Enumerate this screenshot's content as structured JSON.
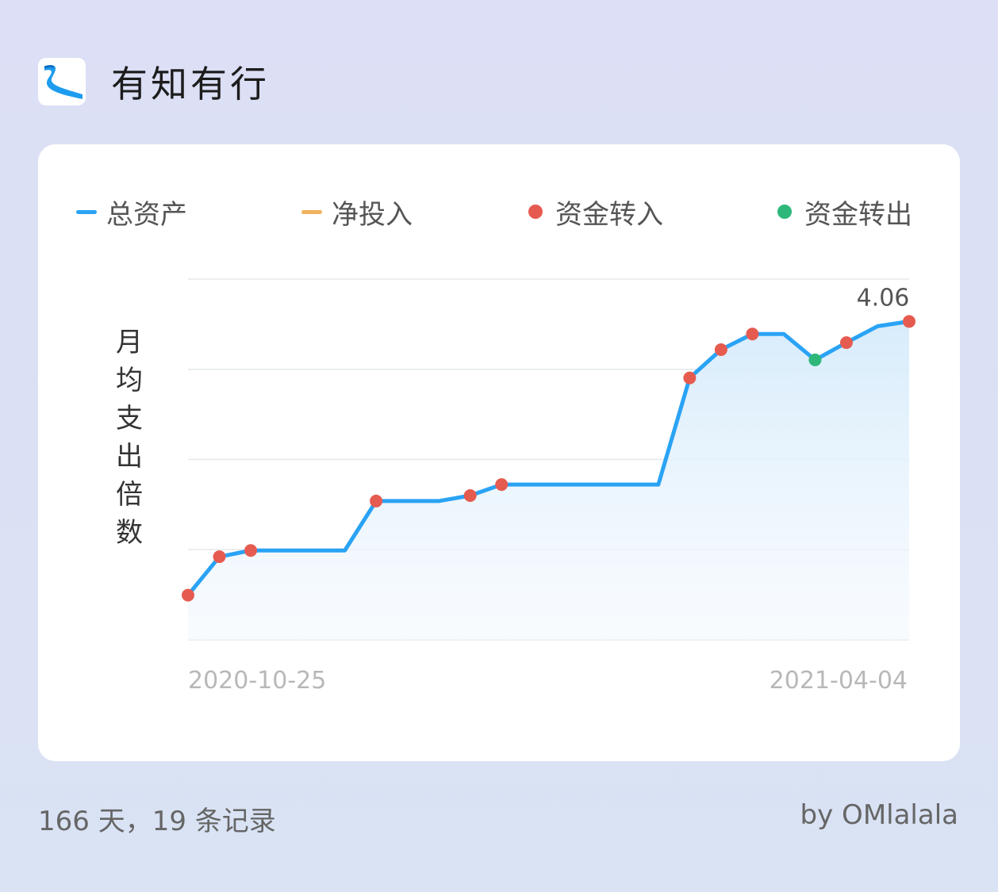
{
  "app": {
    "title": "有知有行",
    "logo_icon": "youzhiyouxing-logo-icon"
  },
  "legend": [
    {
      "label": "总资产",
      "type": "line",
      "color": "#2aa3f5"
    },
    {
      "label": "净投入",
      "type": "line",
      "color": "#f0b25e"
    },
    {
      "label": "资金转入",
      "type": "dot",
      "color": "#e65b50"
    },
    {
      "label": "资金转出",
      "type": "dot",
      "color": "#2db87a"
    }
  ],
  "chart_data": {
    "type": "area",
    "ylabel": "月均支出倍数",
    "ylim": [
      0,
      4.6
    ],
    "grid_values": [
      0,
      1.15,
      2.3,
      3.45,
      4.6
    ],
    "x_ticks": [
      "2020-10-25",
      "2021-04-04"
    ],
    "last_value_label": "4.06",
    "series": [
      {
        "name": "总资产",
        "color": "#2aa3f5",
        "x": [
          0,
          1,
          2,
          3,
          4,
          5,
          6,
          7,
          8,
          9,
          10,
          11,
          12,
          13,
          14,
          15,
          16,
          17,
          18,
          19,
          20,
          21,
          22,
          23
        ],
        "y": [
          0.57,
          1.06,
          1.14,
          1.14,
          1.14,
          1.14,
          1.77,
          1.77,
          1.77,
          1.84,
          1.98,
          1.98,
          1.98,
          1.98,
          1.98,
          1.98,
          3.34,
          3.7,
          3.9,
          3.9,
          3.57,
          3.79,
          4.0,
          4.06
        ],
        "point_events": [
          "in",
          "in",
          "in",
          null,
          null,
          null,
          "in",
          null,
          null,
          "in",
          "in",
          null,
          null,
          null,
          null,
          null,
          "in",
          "in",
          "in",
          null,
          "out",
          "in",
          null,
          "in"
        ]
      }
    ]
  },
  "footer": {
    "stats": "166 天，19 条记录",
    "credit": "by OMlalala"
  }
}
